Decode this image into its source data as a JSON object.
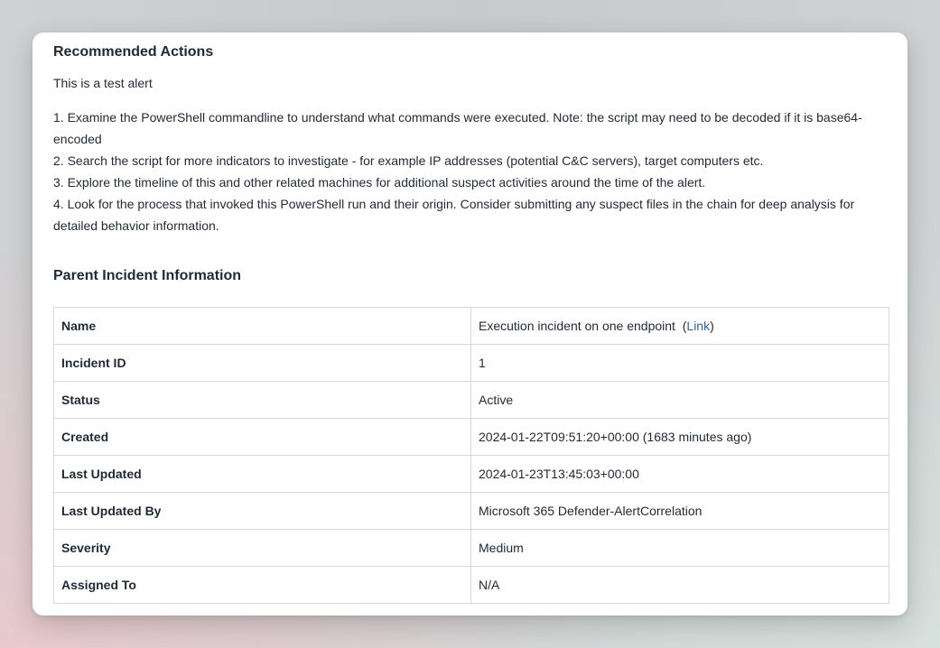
{
  "recommended": {
    "heading": "Recommended Actions",
    "intro": "This is a test alert",
    "steps": [
      "1. Examine the PowerShell commandline to understand what commands were executed. Note: the script may need to be decoded if it is base64-encoded",
      "2. Search the script for more indicators to investigate - for example IP addresses (potential C&C servers), target computers etc.",
      "3. Explore the timeline of this and other related machines for additional suspect activities around the time of the alert.",
      "4. Look for the process that invoked this PowerShell run and their origin. Consider submitting any suspect files in the chain for deep analysis for detailed behavior information."
    ]
  },
  "parent_incident": {
    "heading": "Parent Incident Information",
    "rows": [
      {
        "key": "Name",
        "value": "Execution incident on one endpoint",
        "link_text": "Link"
      },
      {
        "key": "Incident ID",
        "value": "1"
      },
      {
        "key": "Status",
        "value": "Active"
      },
      {
        "key": "Created",
        "value": "2024-01-22T09:51:20+00:00 (1683 minutes ago)"
      },
      {
        "key": "Last Updated",
        "value": "2024-01-23T13:45:03+00:00"
      },
      {
        "key": "Last Updated By",
        "value": "Microsoft 365 Defender-AlertCorrelation"
      },
      {
        "key": "Severity",
        "value": "Medium"
      },
      {
        "key": "Assigned To",
        "value": "N/A"
      }
    ]
  }
}
